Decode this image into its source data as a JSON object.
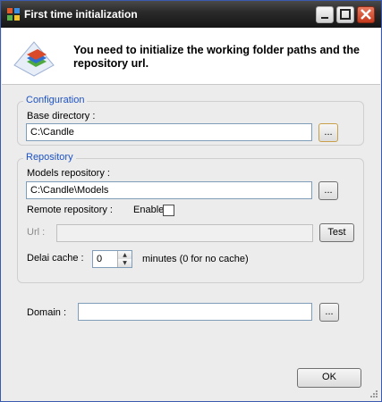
{
  "window": {
    "title": "First time initialization"
  },
  "header": {
    "message": "You need to initialize the working folder paths and the repository url."
  },
  "configuration": {
    "group_title": "Configuration",
    "base_directory_label": "Base directory :",
    "base_directory_value": "C:\\Candle",
    "browse_label": "..."
  },
  "repository": {
    "group_title": "Repository",
    "models_label": "Models repository :",
    "models_value": "C:\\Candle\\Models",
    "browse_label": "...",
    "remote_label": "Remote repository :",
    "enabled_label": "Enabled",
    "enabled_checked": false,
    "url_label": "Url :",
    "url_value": "",
    "test_label": "Test",
    "cache_label": "Delai cache :",
    "cache_value": "0",
    "cache_hint": "minutes (0 for no cache)"
  },
  "domain": {
    "label": "Domain :",
    "value": "",
    "browse_label": "..."
  },
  "footer": {
    "ok_label": "OK"
  }
}
